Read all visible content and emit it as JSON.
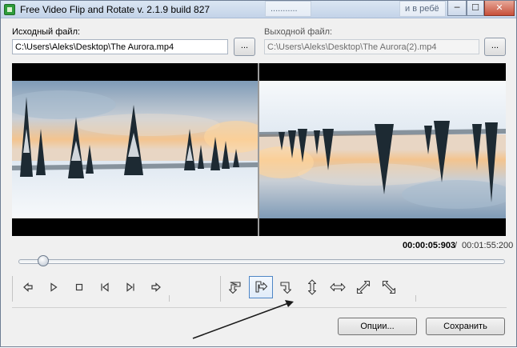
{
  "window": {
    "title": "Free Video Flip and Rotate  v. 2.1.9 build 827",
    "background_hints": [
      "...........",
      "и в ребё"
    ]
  },
  "title_buttons": [
    {
      "name": "minimize",
      "glyph": "─"
    },
    {
      "name": "maximize",
      "glyph": "☐"
    },
    {
      "name": "close",
      "glyph": "✕"
    }
  ],
  "input": {
    "label": "Исходный файл:",
    "value": "C:\\Users\\Aleks\\Desktop\\The Aurora.mp4",
    "browse_label": "..."
  },
  "output": {
    "label": "Выходной файл:",
    "value": "C:\\Users\\Aleks\\Desktop\\The Aurora(2).mp4",
    "browse_label": "..."
  },
  "preview": {
    "left": "original winter landscape frame",
    "right": "vertically flipped winter landscape frame"
  },
  "time": {
    "current": "00:00:05:903",
    "separator": "/",
    "total": "00:01:55:200"
  },
  "slider": {
    "position_fraction": 0.051
  },
  "playback": [
    {
      "name": "step-back",
      "icon": "step-back-icon"
    },
    {
      "name": "play",
      "icon": "play-icon"
    },
    {
      "name": "stop",
      "icon": "stop-icon"
    },
    {
      "name": "prev-frame",
      "icon": "prev-frame-icon"
    },
    {
      "name": "next-frame",
      "icon": "next-frame-icon"
    },
    {
      "name": "step-forward",
      "icon": "step-forward-icon"
    }
  ],
  "transforms": [
    {
      "name": "rotate-left",
      "icon": "rotate-left-icon",
      "active": false
    },
    {
      "name": "rotate-right",
      "icon": "rotate-right-icon",
      "active": true
    },
    {
      "name": "rotate-180",
      "icon": "rotate-180-icon",
      "active": false
    },
    {
      "name": "flip-vertical",
      "icon": "flip-vertical-icon",
      "active": false
    },
    {
      "name": "flip-horizontal",
      "icon": "flip-horizontal-icon",
      "active": false
    },
    {
      "name": "transpose",
      "icon": "transpose-icon",
      "active": false
    },
    {
      "name": "transverse",
      "icon": "transverse-icon",
      "active": false
    }
  ],
  "buttons": {
    "options": "Опции...",
    "save": "Сохранить"
  },
  "colors": {
    "accent": "#4e86c6",
    "icon": "#3a3a3a"
  }
}
